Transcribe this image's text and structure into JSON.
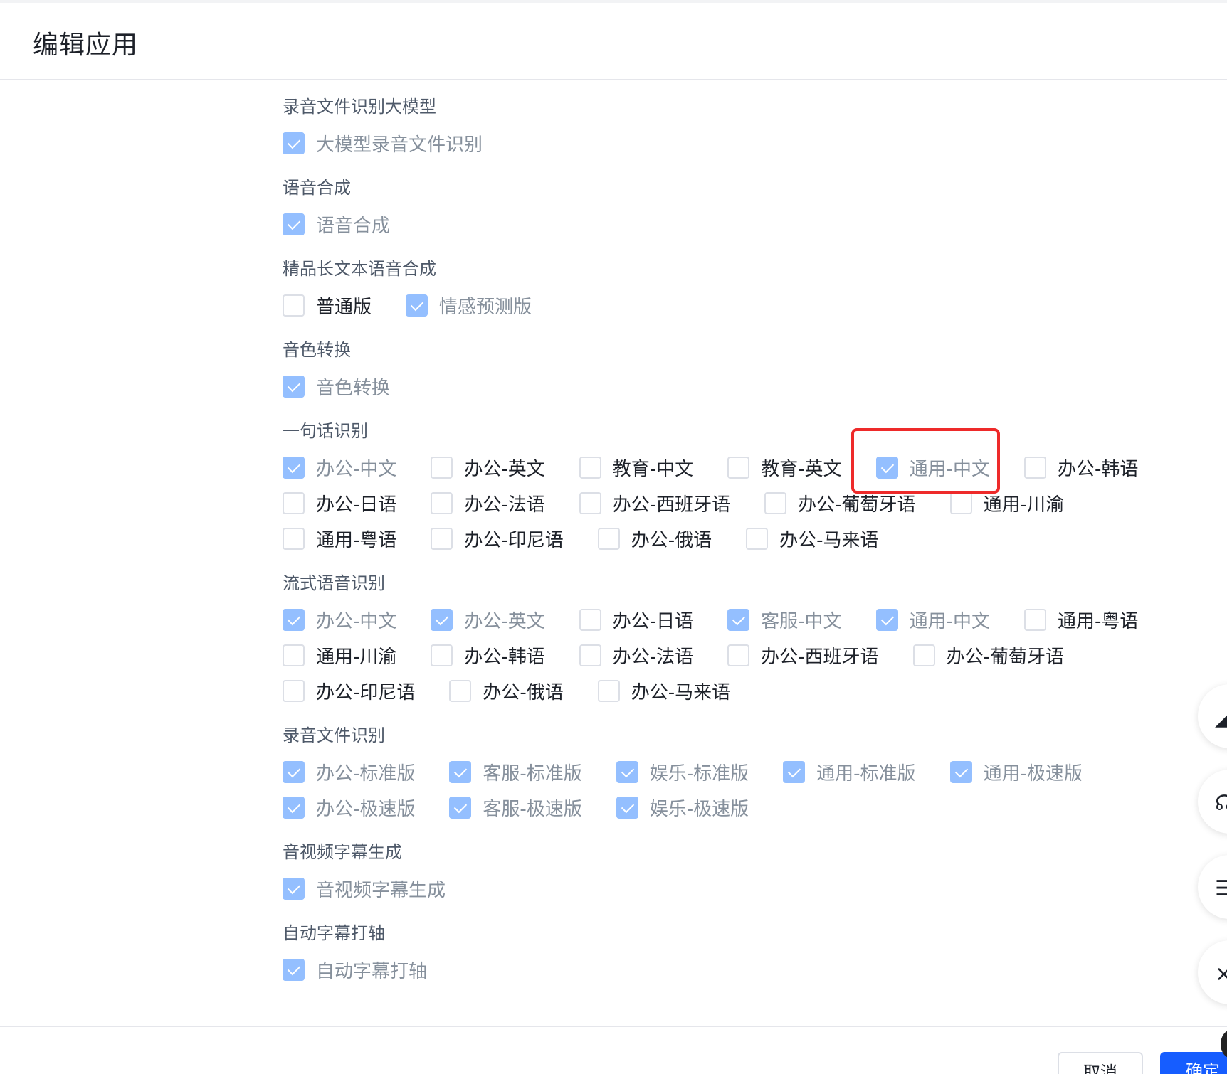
{
  "header": {
    "title": "编辑应用"
  },
  "colors": {
    "checked": "#94bfff",
    "primary": "#165dff",
    "highlight": "#ee2a2a"
  },
  "sections": [
    {
      "title": "录音文件识别大模型",
      "rows": [
        [
          "大模型录音文件识别"
        ]
      ]
    },
    {
      "title": "语音合成",
      "rows": [
        [
          "语音合成"
        ]
      ]
    },
    {
      "title": "精品长文本语音合成",
      "rows": [
        [
          "普通版",
          "情感预测版"
        ]
      ]
    },
    {
      "title": "音色转换",
      "rows": [
        [
          "音色转换"
        ]
      ]
    },
    {
      "title": "一句话识别",
      "rows": [
        [
          "办公-中文",
          "办公-英文",
          "教育-中文",
          "教育-英文",
          "通用-中文",
          "办公-韩语"
        ],
        [
          "办公-日语",
          "办公-法语",
          "办公-西班牙语",
          "办公-葡萄牙语",
          "通用-川渝"
        ],
        [
          "通用-粤语",
          "办公-印尼语",
          "办公-俄语",
          "办公-马来语"
        ]
      ]
    },
    {
      "title": "流式语音识别",
      "rows": [
        [
          "办公-中文",
          "办公-英文",
          "办公-日语",
          "客服-中文",
          "通用-中文",
          "通用-粤语"
        ],
        [
          "通用-川渝",
          "办公-韩语",
          "办公-法语",
          "办公-西班牙语",
          "办公-葡萄牙语"
        ],
        [
          "办公-印尼语",
          "办公-俄语",
          "办公-马来语"
        ]
      ]
    },
    {
      "title": "录音文件识别",
      "rows": [
        [
          "办公-标准版",
          "客服-标准版",
          "娱乐-标准版",
          "通用-标准版",
          "通用-极速版"
        ],
        [
          "办公-极速版",
          "客服-极速版",
          "娱乐-极速版"
        ]
      ]
    },
    {
      "title": "音视频字幕生成",
      "rows": [
        [
          "音视频字幕生成"
        ]
      ]
    },
    {
      "title": "自动字幕打轴",
      "rows": [
        [
          "自动字幕打轴"
        ]
      ]
    }
  ],
  "footer": {
    "cancel_label": "取消",
    "confirm_label": "确定"
  }
}
